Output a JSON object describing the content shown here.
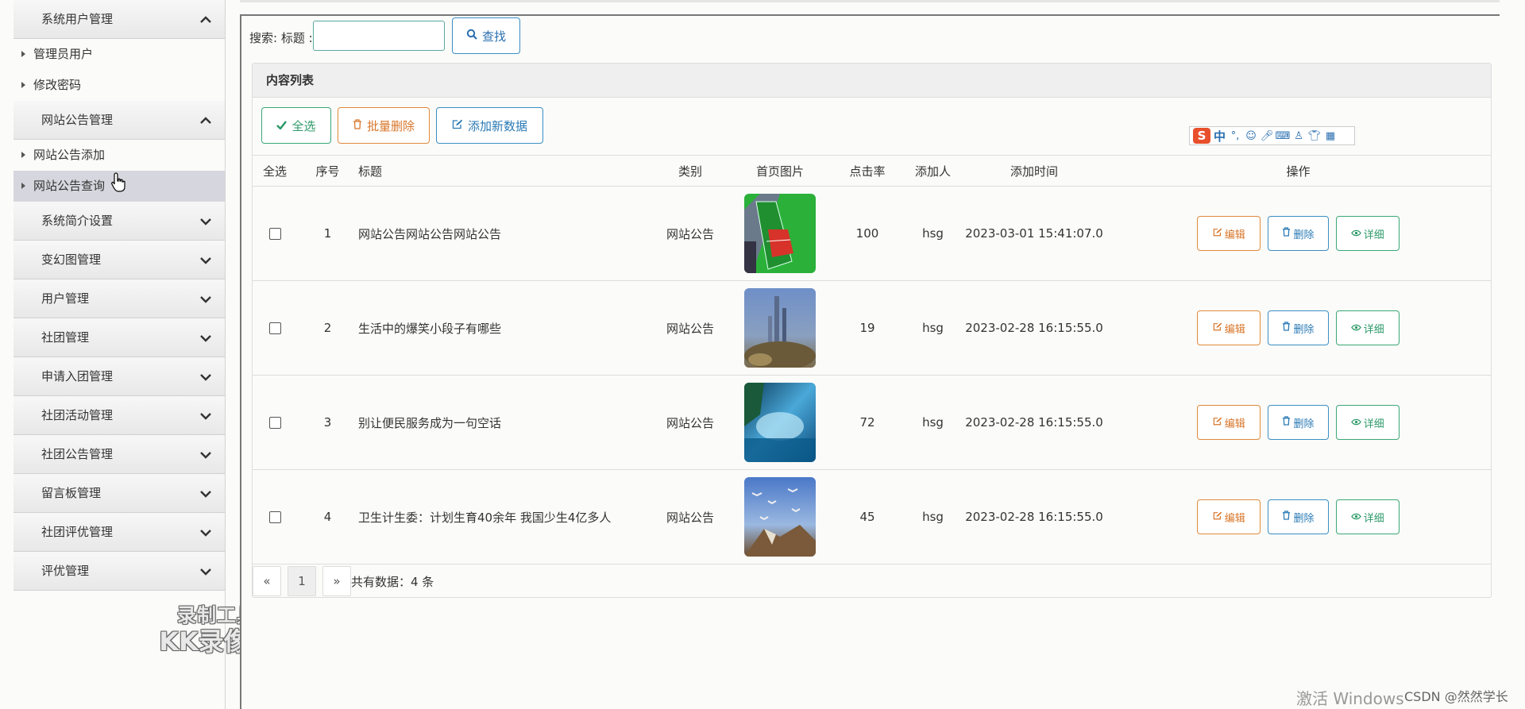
{
  "sidebar": {
    "groups": [
      {
        "label": "系统用户管理",
        "expanded": true,
        "subs": [
          "管理员用户",
          "修改密码"
        ]
      },
      {
        "label": "网站公告管理",
        "expanded": true,
        "subs": [
          "网站公告添加",
          "网站公告查询"
        ]
      },
      {
        "label": "系统简介设置",
        "expanded": false
      },
      {
        "label": "变幻图管理",
        "expanded": false
      },
      {
        "label": "用户管理",
        "expanded": false
      },
      {
        "label": "社团管理",
        "expanded": false
      },
      {
        "label": "申请入团管理",
        "expanded": false
      },
      {
        "label": "社团活动管理",
        "expanded": false
      },
      {
        "label": "社团公告管理",
        "expanded": false
      },
      {
        "label": "留言板管理",
        "expanded": false
      },
      {
        "label": "社团评优管理",
        "expanded": false
      },
      {
        "label": "评优管理",
        "expanded": false
      }
    ]
  },
  "watermark": {
    "line1": "录制工具",
    "line2": "KK录像机"
  },
  "search": {
    "label": "搜索: 标题 :",
    "value": "",
    "button": "查找"
  },
  "panel": {
    "title": "内容列表"
  },
  "toolbar": {
    "select_all": "全选",
    "batch_delete": "批量删除",
    "add_new": "添加新数据"
  },
  "ime": {
    "char": "中"
  },
  "table": {
    "headers": [
      "全选",
      "序号",
      "标题",
      "类别",
      "首页图片",
      "点击率",
      "添加人",
      "添加时间",
      "操作"
    ],
    "rows": [
      {
        "no": "1",
        "title": "网站公告网站公告网站公告",
        "category": "网站公告",
        "clicks": "100",
        "author": "hsg",
        "time": "2023-03-01 15:41:07.0",
        "image": "green-court"
      },
      {
        "no": "2",
        "title": "生活中的爆笑小段子有哪些",
        "category": "网站公告",
        "clicks": "19",
        "author": "hsg",
        "time": "2023-02-28 16:15:55.0",
        "image": "fantasy-tower"
      },
      {
        "no": "3",
        "title": "别让便民服务成为一句空话",
        "category": "网站公告",
        "clicks": "72",
        "author": "hsg",
        "time": "2023-02-28 16:15:55.0",
        "image": "blue-lake"
      },
      {
        "no": "4",
        "title": "卫生计生委：计划生育40余年 我国少生4亿多人",
        "category": "网站公告",
        "clicks": "45",
        "author": "hsg",
        "time": "2023-02-28 16:15:55.0",
        "image": "sky-birds"
      }
    ],
    "actions": {
      "edit": "编辑",
      "delete": "删除",
      "detail": "详细"
    }
  },
  "pagination": {
    "prev": "«",
    "page": "1",
    "next": "»",
    "total": "共有数据：4 条"
  },
  "footer": {
    "activate": "激活 Windows",
    "csdn": "CSDN @然然学长"
  },
  "colors": {
    "accent_green": "#2e9a6a",
    "accent_orange": "#d8762a",
    "accent_blue": "#2a7ab5"
  }
}
